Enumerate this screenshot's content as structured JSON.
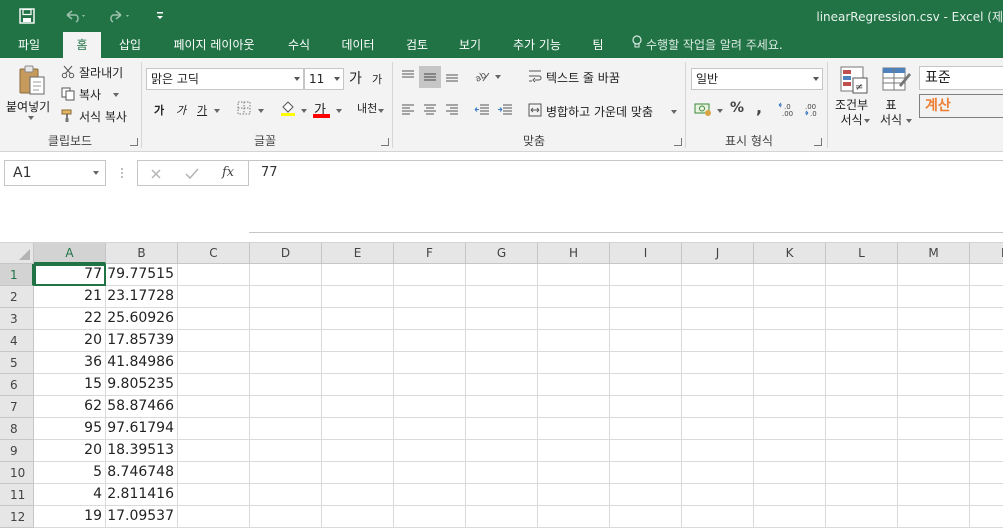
{
  "titlebar": {
    "title": "linearRegression.csv - Excel (제",
    "qat": {
      "save": "save-icon",
      "undo": "undo-icon",
      "redo": "redo-icon",
      "customize": "customize-qat-icon"
    }
  },
  "tabs": [
    {
      "label": "파일"
    },
    {
      "label": "홈"
    },
    {
      "label": "삽입"
    },
    {
      "label": "페이지 레이아웃"
    },
    {
      "label": "수식"
    },
    {
      "label": "데이터"
    },
    {
      "label": "검토"
    },
    {
      "label": "보기"
    },
    {
      "label": "추가 기능"
    },
    {
      "label": "팀"
    }
  ],
  "tell_me": "수행할 작업을 알려 주세요.",
  "ribbon": {
    "clipboard": {
      "paste": "붙여넣기",
      "cut": "잘라내기",
      "copy": "복사",
      "format_painter": "서식 복사",
      "label": "클립보드"
    },
    "font": {
      "name": "맑은 고딕",
      "size": "11",
      "grow": "가",
      "shrink": "가",
      "bold": "가",
      "italic": "가",
      "underline": "가",
      "font_color": "가",
      "phonetic": "내천",
      "label": "글꼴"
    },
    "alignment": {
      "wrap": "텍스트 줄 바꿈",
      "merge": "병합하고 가운데 맞춤",
      "label": "맞춤"
    },
    "number": {
      "format": "일반",
      "percent": "%",
      "comma": ",",
      "label": "표시 형식"
    },
    "styles": {
      "conditional": "조건부 서식",
      "conditional_line1": "조건부",
      "conditional_line2": "서식",
      "table_line1": "표",
      "table_line2": "서식",
      "style_normal": "표준",
      "style_calc": "계산",
      "calc_color": "#ed7d31"
    }
  },
  "formula_bar": {
    "name_box": "A1",
    "fx": "fx",
    "value": "77"
  },
  "grid": {
    "columns": [
      "A",
      "B",
      "C",
      "D",
      "E",
      "F",
      "G",
      "H",
      "I",
      "J",
      "K",
      "L",
      "M",
      "N"
    ],
    "rows": [
      {
        "num": "1",
        "a": "77",
        "b": "79.77515"
      },
      {
        "num": "2",
        "a": "21",
        "b": "23.17728"
      },
      {
        "num": "3",
        "a": "22",
        "b": "25.60926"
      },
      {
        "num": "4",
        "a": "20",
        "b": "17.85739"
      },
      {
        "num": "5",
        "a": "36",
        "b": "41.84986"
      },
      {
        "num": "6",
        "a": "15",
        "b": "9.805235"
      },
      {
        "num": "7",
        "a": "62",
        "b": "58.87466"
      },
      {
        "num": "8",
        "a": "95",
        "b": "97.61794"
      },
      {
        "num": "9",
        "a": "20",
        "b": "18.39513"
      },
      {
        "num": "10",
        "a": "5",
        "b": "8.746748"
      },
      {
        "num": "11",
        "a": "4",
        "b": "2.811416"
      },
      {
        "num": "12",
        "a": "19",
        "b": "17.09537"
      }
    ]
  },
  "colors": {
    "brand": "#217346",
    "ribbon": "#f3f3f3"
  }
}
